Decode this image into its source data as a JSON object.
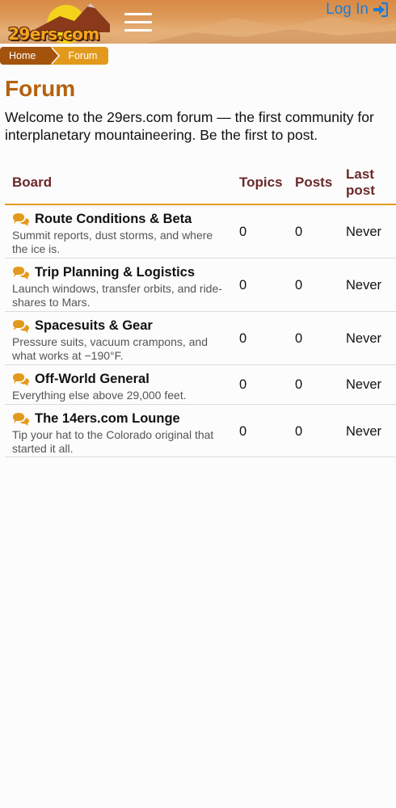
{
  "header": {
    "logo_text": "29ers.com",
    "login_label": "Log In"
  },
  "breadcrumb": {
    "home": "Home",
    "current": "Forum"
  },
  "page": {
    "title": "Forum",
    "intro": "Welcome to the 29ers.com forum — the first community for interplanetary mountaineering. Be the first to post."
  },
  "table": {
    "headers": {
      "board": "Board",
      "topics": "Topics",
      "posts": "Posts",
      "last_post": "Last post"
    },
    "rows": [
      {
        "title": "Route Conditions & Beta",
        "desc": "Summit reports, dust storms, and where the ice is.",
        "topics": "0",
        "posts": "0",
        "last": "Never"
      },
      {
        "title": "Trip Planning & Logistics",
        "desc": "Launch windows, transfer orbits, and ride-shares to Mars.",
        "topics": "0",
        "posts": "0",
        "last": "Never"
      },
      {
        "title": "Spacesuits & Gear",
        "desc": "Pressure suits, vacuum crampons, and what works at −190°F.",
        "topics": "0",
        "posts": "0",
        "last": "Never"
      },
      {
        "title": "Off-World General",
        "desc": "Everything else above 29,000 feet.",
        "topics": "0",
        "posts": "0",
        "last": "Never"
      },
      {
        "title": "The 14ers.com Lounge",
        "desc": "Tip your hat to the Colorado original that started it all.",
        "topics": "0",
        "posts": "0",
        "last": "Never"
      }
    ]
  },
  "colors": {
    "accent": "#e39a1c",
    "title": "#b5620f",
    "header_text": "#6a2a2a",
    "link": "#1f7bd6"
  },
  "icons": [
    "menu-icon",
    "sign-in-icon",
    "comments-icon"
  ]
}
